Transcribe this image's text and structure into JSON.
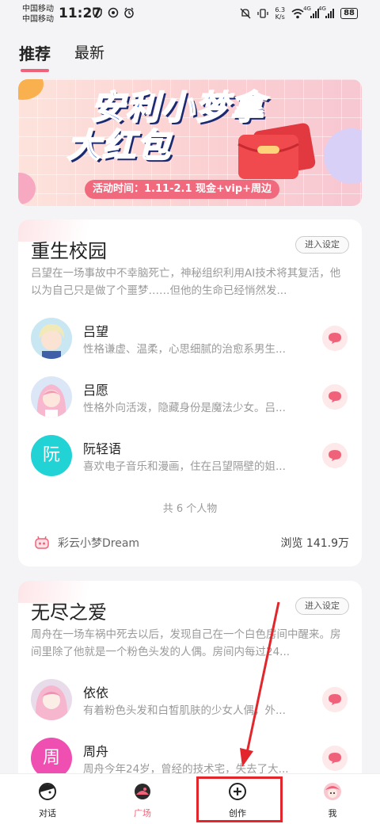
{
  "status_bar": {
    "carrier1": "中国移动",
    "carrier2": "中国移动",
    "time": "11:27",
    "net_speed_value": "6.3",
    "net_speed_unit": "K/s",
    "signal_label1": "4G",
    "signal_label2": "4G",
    "battery": "88"
  },
  "tabs": [
    {
      "label": "推荐",
      "active": true
    },
    {
      "label": "最新",
      "active": false
    }
  ],
  "banner": {
    "title_line1": "安利小梦拿",
    "title_line2": "大红包",
    "subtitle": "活动时间：1.11-2.1 现金+vip+周边"
  },
  "cards": [
    {
      "title": "重生校园",
      "enter_label": "进入设定",
      "description": "吕望在一场事故中不幸脑死亡，神秘组织利用AI技术将其复活，他以为自己只是做了个噩梦……但他的生命已经悄然发...",
      "characters": [
        {
          "name": "吕望",
          "desc": "性格谦虚、温柔，心思细腻的治愈系男生...",
          "avatar": "image",
          "avatar_text": ""
        },
        {
          "name": "吕愿",
          "desc": "性格外向活泼，隐藏身份是魔法少女。吕...",
          "avatar": "image",
          "avatar_text": ""
        },
        {
          "name": "阮轻语",
          "desc": "喜欢电子音乐和漫画，住在吕望隔壁的姐...",
          "avatar": "text",
          "avatar_text": "阮"
        }
      ],
      "count_text": "共 6 个人物",
      "author": "彩云小梦Dream",
      "views": "浏览 141.9万"
    },
    {
      "title": "无尽之爱",
      "enter_label": "进入设定",
      "description": "周舟在一场车祸中死去以后，发现自己在一个白色房间中醒来。房间里除了他就是一个粉色头发的人偶。房间内每过24...",
      "characters": [
        {
          "name": "依依",
          "desc": "有着粉色头发和白皙肌肤的少女人偶，外...",
          "avatar": "image",
          "avatar_text": ""
        },
        {
          "name": "周舟",
          "desc": "周舟今年24岁，曾经的技术宅，失去了大...",
          "avatar": "text",
          "avatar_text": "周"
        }
      ]
    }
  ],
  "bottom_nav": [
    {
      "label": "对话",
      "icon": "chat-face-icon",
      "active": false
    },
    {
      "label": "广场",
      "icon": "plaza-icon",
      "active": true
    },
    {
      "label": "创作",
      "icon": "plus-circle-icon",
      "active": false
    },
    {
      "label": "我",
      "icon": "profile-avatar-icon",
      "active": false
    }
  ],
  "colors": {
    "accent": "#f06279",
    "annotation_red": "#e3262b",
    "avatar_teal": "#22d3d6",
    "avatar_pink": "#ef4fb0"
  }
}
